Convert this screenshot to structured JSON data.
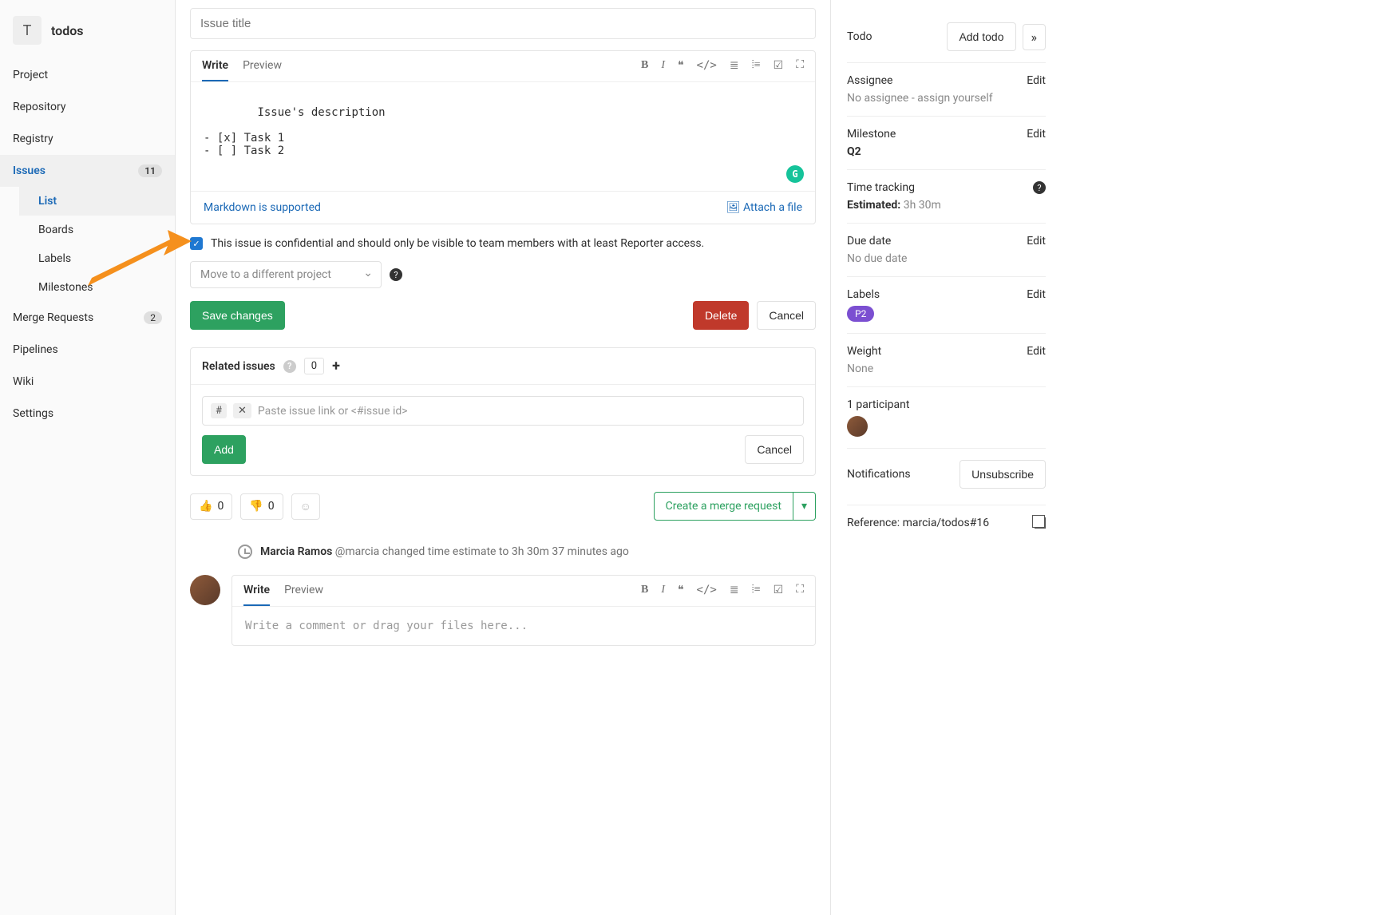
{
  "project": {
    "avatar_letter": "T",
    "name": "todos"
  },
  "sidebar": {
    "items": [
      {
        "label": "Project"
      },
      {
        "label": "Repository"
      },
      {
        "label": "Registry"
      },
      {
        "label": "Issues",
        "count": "11",
        "active": true,
        "sub": [
          {
            "label": "List",
            "active": true
          },
          {
            "label": "Boards"
          },
          {
            "label": "Labels"
          },
          {
            "label": "Milestones"
          }
        ]
      },
      {
        "label": "Merge Requests",
        "count": "2"
      },
      {
        "label": "Pipelines"
      },
      {
        "label": "Wiki"
      },
      {
        "label": "Settings"
      }
    ]
  },
  "editor": {
    "title_placeholder": "Issue title",
    "tabs": {
      "write": "Write",
      "preview": "Preview"
    },
    "body": "Issue's description\n\n- [x] Task 1\n- [ ] Task 2",
    "markdown_link": "Markdown is supported",
    "attach_link": "Attach a file"
  },
  "confidential": {
    "checked": true,
    "label": "This issue is confidential and should only be visible to team members with at least Reporter access."
  },
  "move": {
    "placeholder": "Move to a different project"
  },
  "buttons": {
    "save": "Save changes",
    "delete": "Delete",
    "cancel": "Cancel"
  },
  "related": {
    "title": "Related issues",
    "count": "0",
    "chip": "#",
    "chip_x": "✕",
    "input_placeholder": "Paste issue link or <#issue id>",
    "add": "Add",
    "cancel": "Cancel"
  },
  "reactions": {
    "thumbs_up": "0",
    "thumbs_down": "0"
  },
  "merge_request_btn": "Create a merge request",
  "activity": {
    "author": "Marcia Ramos",
    "handle": "@marcia",
    "text": "changed time estimate to 3h 30m 37 minutes ago"
  },
  "comment": {
    "tabs": {
      "write": "Write",
      "preview": "Preview"
    },
    "placeholder": "Write a comment or drag your files here..."
  },
  "rightbar": {
    "todo": {
      "title": "Todo",
      "button": "Add todo"
    },
    "assignee": {
      "title": "Assignee",
      "edit": "Edit",
      "value": "No assignee - ",
      "assign_self": "assign yourself"
    },
    "milestone": {
      "title": "Milestone",
      "edit": "Edit",
      "value": "Q2"
    },
    "time": {
      "title": "Time tracking",
      "estimated_label": "Estimated:",
      "estimated_value": "3h 30m"
    },
    "due": {
      "title": "Due date",
      "edit": "Edit",
      "value": "No due date"
    },
    "labels": {
      "title": "Labels",
      "edit": "Edit",
      "pill": "P2"
    },
    "weight": {
      "title": "Weight",
      "edit": "Edit",
      "value": "None"
    },
    "participants": {
      "title": "1 participant"
    },
    "notifications": {
      "title": "Notifications",
      "button": "Unsubscribe"
    },
    "reference": {
      "label": "Reference:",
      "value": "marcia/todos#16"
    }
  }
}
